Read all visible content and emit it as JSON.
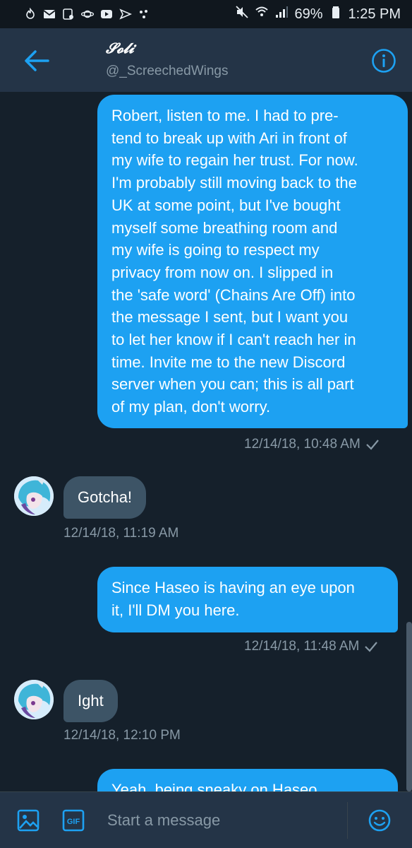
{
  "status_bar": {
    "battery_percent": "69%",
    "time": "1:25 PM",
    "left_icons": [
      "tinder-icon",
      "gmail-icon",
      "notes-icon",
      "saturn-icon",
      "youtube-icon",
      "mail-icon",
      "dots-icon"
    ],
    "right_icons": [
      "mute-icon",
      "wifi-icon",
      "signal-icon",
      "battery-icon"
    ]
  },
  "header": {
    "name": "𝓢𝓸𝓵𝓲",
    "handle": "@_ScreechedWings"
  },
  "messages": [
    {
      "side": "sent",
      "text": "Robert, listen to me. I had to pre-\ntend to break up with Ari in front of\nmy wife to regain her trust. For now.\nI'm probably still moving back to the\nUK at some point, but I've bought\nmyself some breathing room and\nmy wife is going to respect my\nprivacy from now on. I slipped in\nthe 'safe word' (Chains Are Off) into\nthe message I sent, but I want you\nto let her know if I can't reach her in\ntime. Invite me to the new Discord\nserver when you can; this is all part\nof my plan, don't worry.",
      "timestamp": "12/14/18, 10:48 AM"
    },
    {
      "side": "recv",
      "text": "Gotcha!",
      "timestamp": "12/14/18, 11:19 AM"
    },
    {
      "side": "sent",
      "text": "Since Haseo is having an eye upon\nit, I'll DM you here.",
      "timestamp": "12/14/18, 11:48 AM"
    },
    {
      "side": "recv",
      "text": "Ight",
      "timestamp": "12/14/18, 12:10 PM"
    },
    {
      "side": "sent",
      "text": "Yeah, being sneaky on Haseo"
    }
  ],
  "composer": {
    "placeholder": "Start a message",
    "gif_label": "GIF"
  },
  "colors": {
    "background": "#15202b",
    "header": "#243447",
    "sent_bubble": "#1da1f2",
    "received_bubble": "#3d5466",
    "accent": "#1da1f2",
    "muted_text": "#8899a6"
  }
}
